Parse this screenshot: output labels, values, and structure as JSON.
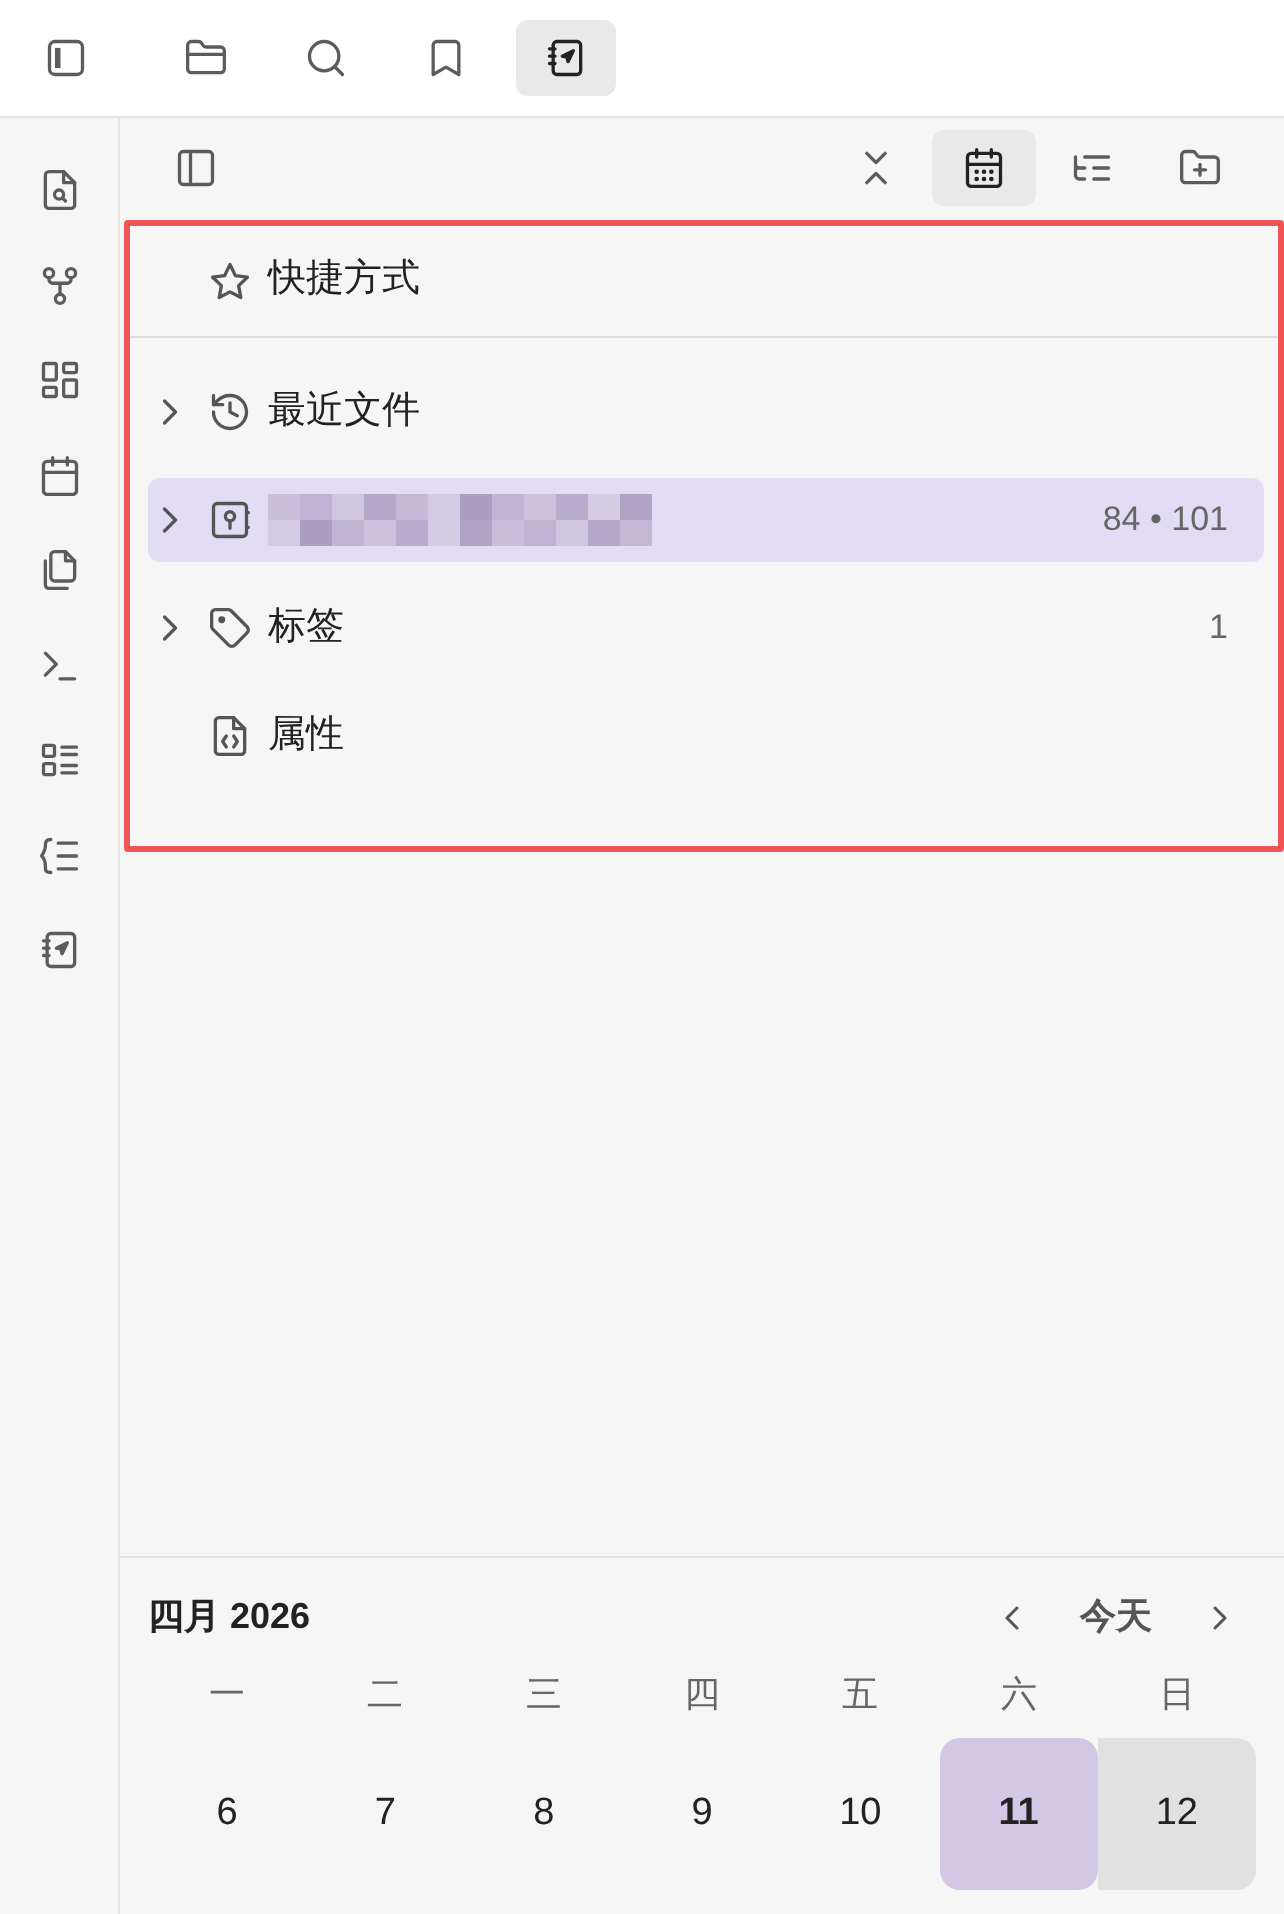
{
  "top_tabs": [
    {
      "selected": false
    },
    {
      "selected": false
    },
    {
      "selected": false
    },
    {
      "selected": true
    }
  ],
  "nav_header": {
    "buttons": [
      {
        "selected": false
      },
      {
        "selected": false
      },
      {
        "selected": true
      },
      {
        "selected": false
      },
      {
        "selected": false
      }
    ]
  },
  "tree": [
    {
      "kind": "pinned",
      "label": "快捷方式",
      "expandable": false,
      "selected": false
    },
    {
      "kind": "section",
      "label": "最近文件",
      "expandable": true,
      "selected": false
    },
    {
      "kind": "vault",
      "expandable": true,
      "selected": true,
      "count": "84 • 101"
    },
    {
      "kind": "section",
      "label": "标签",
      "expandable": true,
      "selected": false,
      "count": "1"
    },
    {
      "kind": "section",
      "label": "属性",
      "expandable": false,
      "selected": false
    }
  ],
  "calendar": {
    "title": "四月 2026",
    "today_button": "今天",
    "weekdays": [
      "一",
      "二",
      "三",
      "四",
      "五",
      "六",
      "日"
    ],
    "days": [
      {
        "label": "6",
        "today": false,
        "weekend": false
      },
      {
        "label": "7",
        "today": false,
        "weekend": false
      },
      {
        "label": "8",
        "today": false,
        "weekend": false
      },
      {
        "label": "9",
        "today": false,
        "weekend": false
      },
      {
        "label": "10",
        "today": false,
        "weekend": false
      },
      {
        "label": "11",
        "today": true,
        "weekend": true
      },
      {
        "label": "12",
        "today": false,
        "weekend": true
      }
    ]
  }
}
